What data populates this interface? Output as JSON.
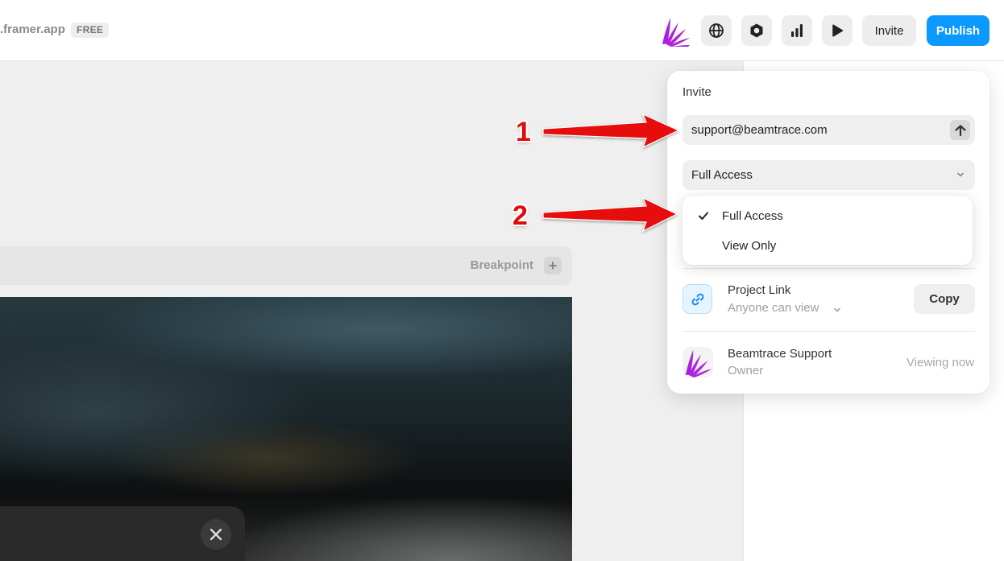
{
  "header": {
    "site_url": ".framer.app",
    "plan_badge": "FREE",
    "icons": [
      "logo-icon",
      "globe-icon",
      "hexagon-icon",
      "analytics-icon",
      "play-icon"
    ],
    "invite_label": "Invite",
    "publish_label": "Publish",
    "publish_color": "#0b99ff"
  },
  "canvas": {
    "breakpoint_label": "Breakpoint"
  },
  "annotations": {
    "marker_1": "1",
    "marker_2": "2",
    "color": "#e10a0a"
  },
  "invite_popover": {
    "title": "Invite",
    "email_value": "support@beamtrace.com",
    "access_selected": "Full Access",
    "access_options": [
      {
        "label": "Full Access",
        "checked": true
      },
      {
        "label": "View Only",
        "checked": false
      }
    ],
    "project_link": {
      "title": "Project Link",
      "subtitle": "Anyone can view",
      "copy_label": "Copy"
    },
    "member": {
      "name": "Beamtrace Support",
      "role": "Owner",
      "status": "Viewing now"
    }
  }
}
